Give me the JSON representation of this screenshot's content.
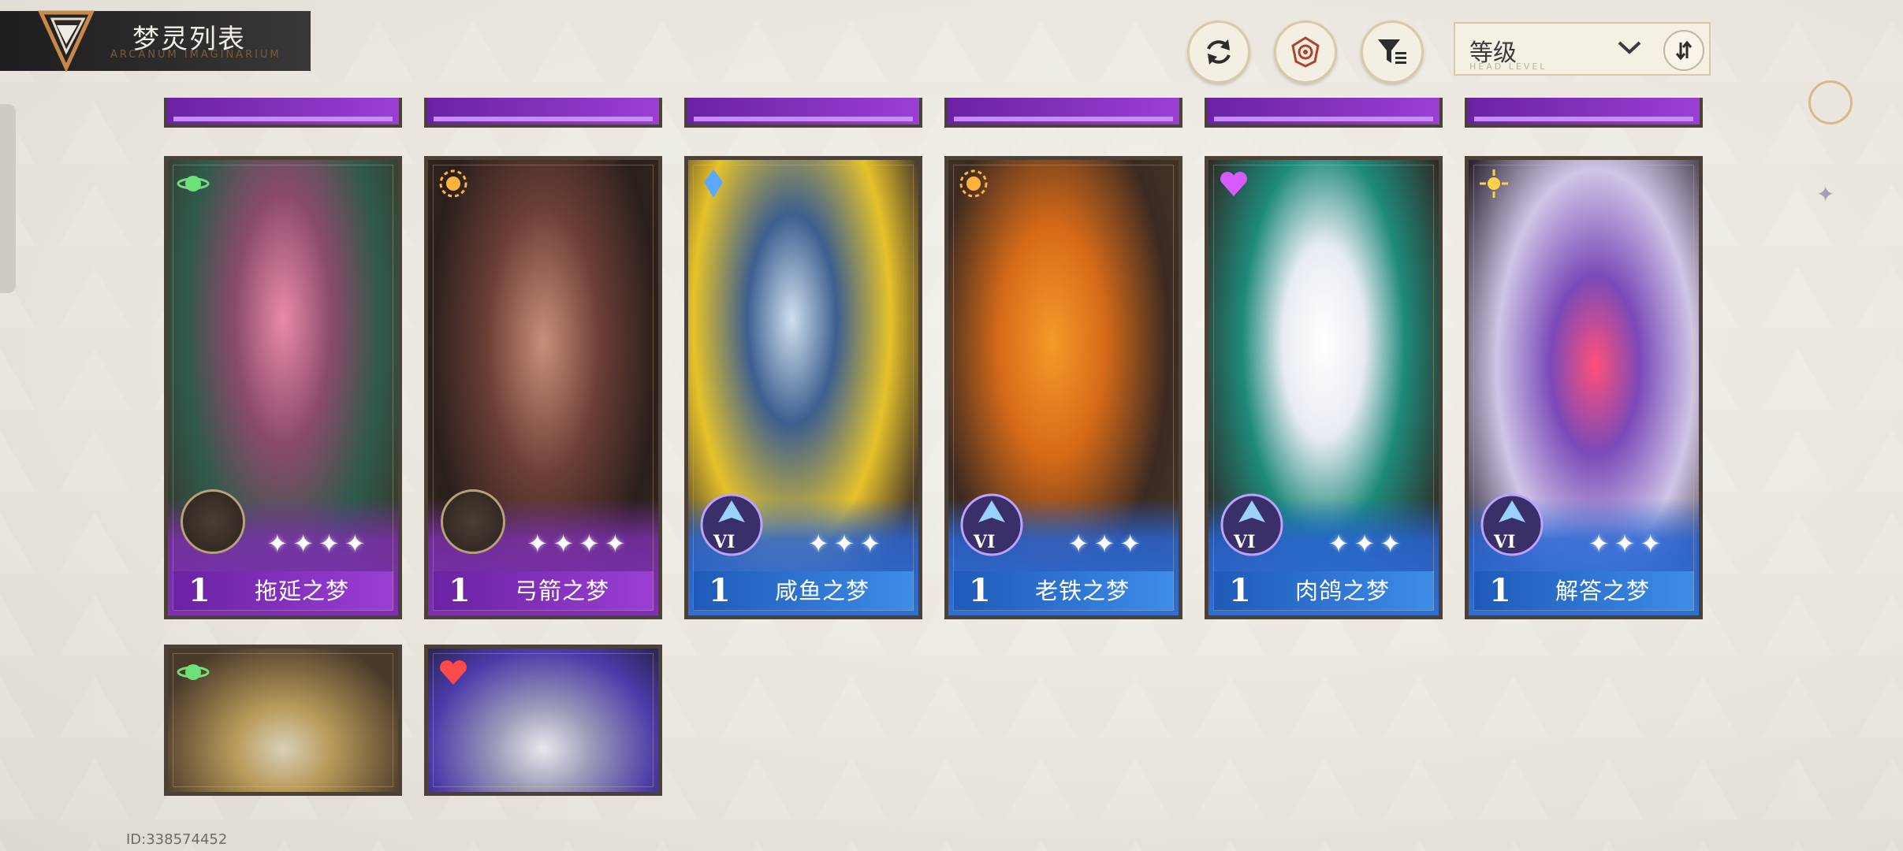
{
  "header": {
    "title": "梦灵列表",
    "subtitle": "ARCANUM IMAGINARIUM",
    "sort_label": "等级",
    "sort_sub": "HEAD LEVEL"
  },
  "toolbar": {
    "refresh_icon": "refresh-icon",
    "target_icon": "target-icon",
    "filter_icon": "filter-icon"
  },
  "colors": {
    "purple": "#7e2fb6",
    "blue": "#2f6fd4",
    "frame": "#4b4137"
  },
  "cards": [
    {
      "level": "1",
      "name": "拖延之梦",
      "stars": "✦✦✦✦",
      "rank": "",
      "element": "planet",
      "theme": "purple"
    },
    {
      "level": "1",
      "name": "弓箭之梦",
      "stars": "✦✦✦✦",
      "rank": "",
      "element": "sun",
      "theme": "purple"
    },
    {
      "level": "1",
      "name": "咸鱼之梦",
      "stars": "✦✦✦",
      "rank": "VI",
      "element": "crystal",
      "theme": "blue"
    },
    {
      "level": "1",
      "name": "老铁之梦",
      "stars": "✦✦✦",
      "rank": "VI",
      "element": "sun",
      "theme": "blue"
    },
    {
      "level": "1",
      "name": "肉鸽之梦",
      "stars": "✦✦✦",
      "rank": "VI",
      "element": "heart",
      "theme": "blue"
    },
    {
      "level": "1",
      "name": "解答之梦",
      "stars": "✦✦✦",
      "rank": "VI",
      "element": "star",
      "theme": "blue"
    }
  ],
  "footer": {
    "id_text": "ID:338574452"
  }
}
